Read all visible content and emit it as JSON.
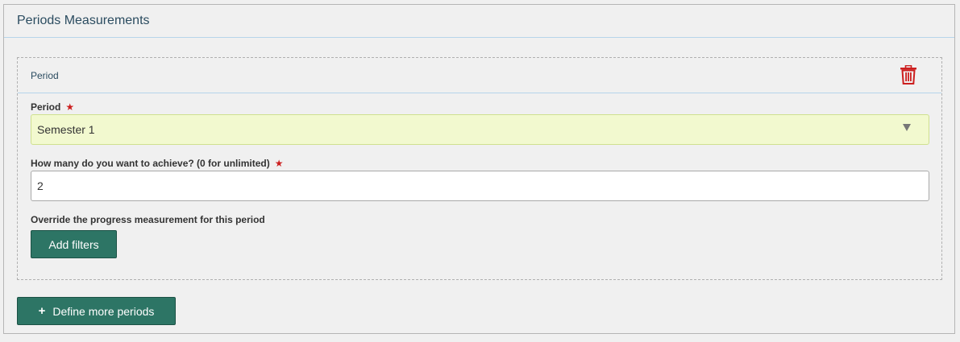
{
  "panel": {
    "title": "Periods Measurements"
  },
  "period": {
    "header_label": "Period",
    "delete_icon": "trash-icon",
    "delete_icon_color": "#cc1f1f",
    "period_field": {
      "label": "Period",
      "required_mark": "★",
      "selected_value": "Semester 1"
    },
    "target_field": {
      "label": "How many do you want to achieve? (0 for unlimited)",
      "required_mark": "★",
      "value": "2"
    },
    "override": {
      "label": "Override the progress measurement for this period",
      "button_label": "Add filters"
    }
  },
  "actions": {
    "define_more_icon": "+",
    "define_more_label": "Define more periods"
  },
  "colors": {
    "accent": "#2d7565",
    "select_bg": "#f2f9cf",
    "required": "#cc1f1f",
    "header_text": "#2b4c60"
  }
}
